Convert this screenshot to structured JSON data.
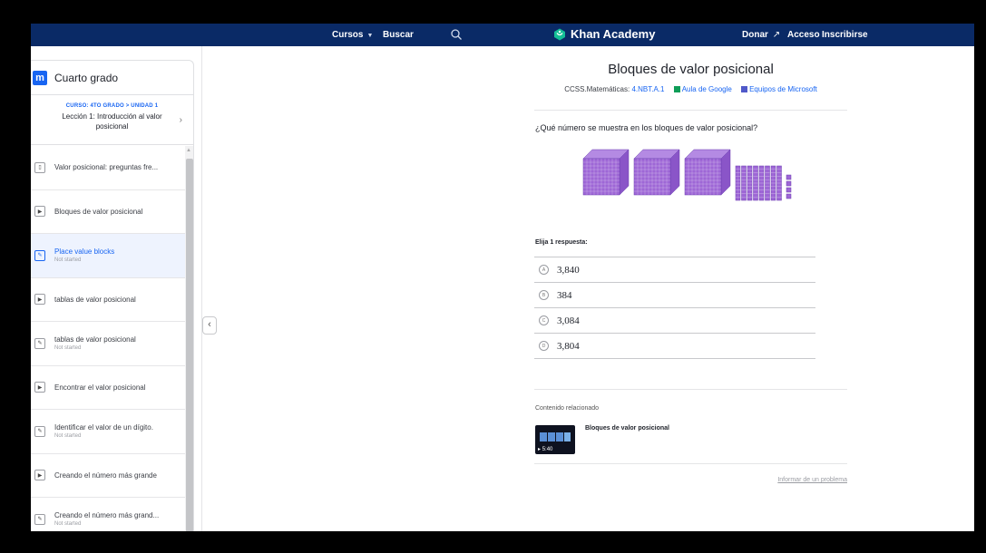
{
  "nav": {
    "cursos": "Cursos",
    "search_label": "Buscar",
    "logo": "Khan Academy",
    "donar": "Donar",
    "acceso": "Acceso",
    "inscribirse": "Inscribirse",
    "bg_color": "#0a2a66"
  },
  "sidebar": {
    "grade_title": "Cuarto grado",
    "book_icon_glyph": "m",
    "breadcrumb": "CURSO: 4TO GRADO > UNIDAD 1",
    "lesson_title": "Lección 1: Introducción al valor posicional",
    "items": [
      {
        "label": "Valor posicional: preguntas fre...",
        "status": "",
        "icon": "article-icon",
        "glyph": "▯"
      },
      {
        "label": "Bloques de valor posicional",
        "status": "",
        "icon": "video-icon",
        "glyph": "▶"
      },
      {
        "label": "Place value blocks",
        "status": "Not started",
        "icon": "exercise-icon",
        "glyph": "✎"
      },
      {
        "label": "tablas de valor posicional",
        "status": "",
        "icon": "video-icon",
        "glyph": "▶"
      },
      {
        "label": "tablas de valor posicional",
        "status": "Not started",
        "icon": "exercise-icon",
        "glyph": "✎"
      },
      {
        "label": "Encontrar el valor posicional",
        "status": "",
        "icon": "video-icon",
        "glyph": "▶"
      },
      {
        "label": "Identificar el valor de un dígito.",
        "status": "Not started",
        "icon": "exercise-icon",
        "glyph": "✎"
      },
      {
        "label": "Creando el número más grande",
        "status": "",
        "icon": "video-icon",
        "glyph": "▶"
      },
      {
        "label": "Creando el número más grand...",
        "status": "Not started",
        "icon": "exercise-icon",
        "glyph": "✎"
      }
    ]
  },
  "exercise": {
    "title": "Bloques de valor posicional",
    "standards_prefix": "CCSS.Matemáticas:",
    "standards_link": "4.NBT.A.1",
    "google_classroom": "Aula de Google",
    "microsoft_teams": "Equipos de Microsoft",
    "question": "¿Qué número se muestra en los bloques de valor posicional?",
    "blocks": {
      "thousands": 3,
      "hundreds": 0,
      "tens": 8,
      "ones": 4
    },
    "block_color": "#9e67d6",
    "choose_label": "Elija 1 respuesta:",
    "choices": [
      {
        "letter": "A",
        "value": "3,840"
      },
      {
        "letter": "B",
        "value": "384"
      },
      {
        "letter": "C",
        "value": "3,084"
      },
      {
        "letter": "D",
        "value": "3,804"
      }
    ]
  },
  "related": {
    "label": "Contenido relacionado",
    "title": "Bloques de valor posicional",
    "duration": "5:40"
  },
  "report_link": "Informar de un problema",
  "collapse_glyph": "‹",
  "accent_color": "#1865f2"
}
